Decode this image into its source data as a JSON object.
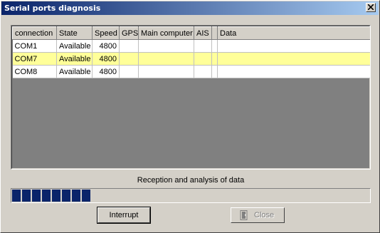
{
  "window": {
    "title": "Serial ports diagnosis"
  },
  "grid": {
    "columns": [
      "connection",
      "State",
      "Speed",
      "GPS",
      "Main computer",
      "AIS",
      "",
      "Data"
    ],
    "rows": [
      {
        "connection": "COM1",
        "state": "Available",
        "speed": "4800",
        "gps": "",
        "main": "",
        "ais": "",
        "x": "",
        "data": "",
        "selected": false
      },
      {
        "connection": "COM7",
        "state": "Available",
        "speed": "4800",
        "gps": "",
        "main": "",
        "ais": "",
        "x": "",
        "data": "",
        "selected": true
      },
      {
        "connection": "COM8",
        "state": "Available",
        "speed": "4800",
        "gps": "",
        "main": "",
        "ais": "",
        "x": "",
        "data": "",
        "selected": false
      }
    ]
  },
  "progress": {
    "caption": "Reception and analysis of data",
    "blocks_filled": 8
  },
  "buttons": {
    "interrupt": "Interrupt",
    "close": "Close"
  },
  "icons": {
    "close_window": "close-icon",
    "door": "door-icon"
  },
  "colors": {
    "selection": "#ffff99",
    "progress": "#0a246a",
    "title_start": "#0a246a",
    "title_end": "#a6caf0"
  }
}
